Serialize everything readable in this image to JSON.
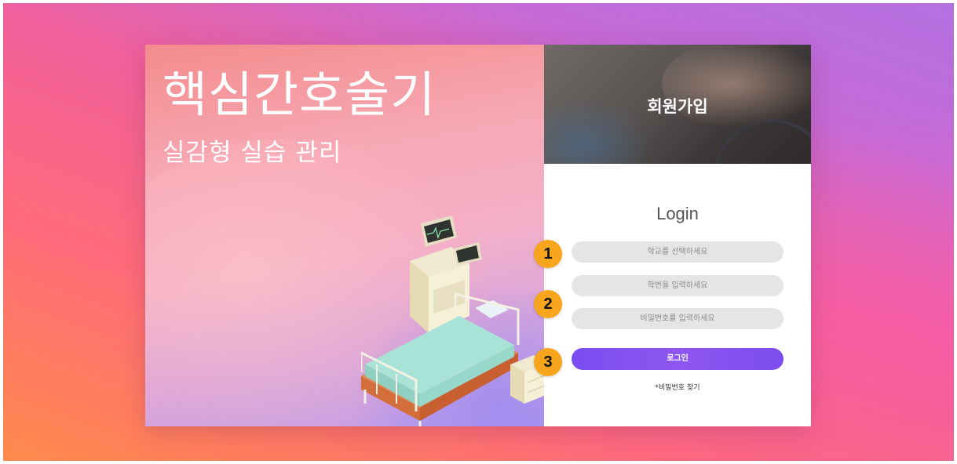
{
  "hero": {
    "title": "핵심간호술기",
    "subtitle": "실감형 실습 관리",
    "illustration": "hospital-bed-with-monitor-illustration"
  },
  "signup": {
    "label": "회원가입"
  },
  "login": {
    "title": "Login",
    "school_placeholder": "학교를 선택하세요",
    "student_id_placeholder": "학번을 입력하세요",
    "password_placeholder": "비밀번호를 입력하세요",
    "submit_label": "로그인",
    "forgot_password": "*비밀번호 찾기"
  },
  "badges": [
    "1",
    "2",
    "3"
  ],
  "colors": {
    "accent": "#7f4ff0",
    "badge": "#f7a51c",
    "field_bg": "#e5e5e5"
  }
}
